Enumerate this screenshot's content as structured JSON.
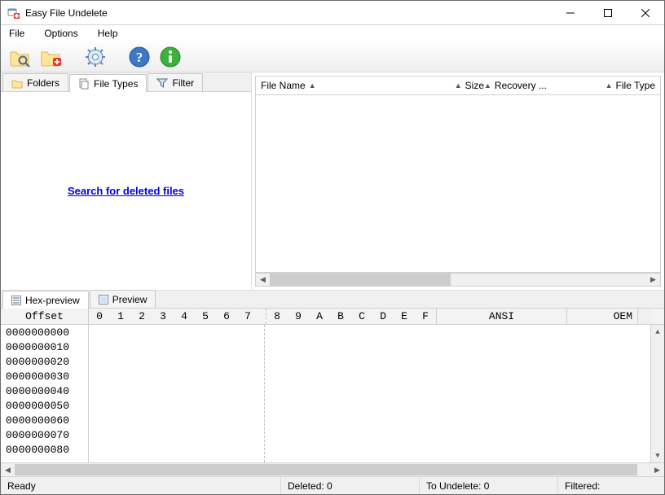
{
  "window": {
    "title": "Easy File Undelete"
  },
  "menus": {
    "file": "File",
    "options": "Options",
    "help": "Help"
  },
  "toolbar": {
    "icons": {
      "scan": "folder-search-icon",
      "add_folder": "folder-add-icon",
      "settings": "gear-icon",
      "help": "help-icon",
      "about": "info-icon"
    }
  },
  "nav_tabs": {
    "folders": "Folders",
    "file_types": "File Types",
    "filter": "Filter"
  },
  "search_link": "Search for deleted files",
  "file_list": {
    "columns": {
      "name": "File Name",
      "size": "Size",
      "recovery": "Recovery ...",
      "type": "File Type"
    }
  },
  "preview_tabs": {
    "hex": "Hex-preview",
    "preview": "Preview"
  },
  "hex": {
    "offset_header": "Offset",
    "byte_cols_left": [
      "0",
      "1",
      "2",
      "3",
      "4",
      "5",
      "6",
      "7"
    ],
    "byte_cols_right": [
      "8",
      "9",
      "A",
      "B",
      "C",
      "D",
      "E",
      "F"
    ],
    "ansi_header": "ANSI",
    "oem_header": "OEM",
    "offsets": [
      "0000000000",
      "0000000010",
      "0000000020",
      "0000000030",
      "0000000040",
      "0000000050",
      "0000000060",
      "0000000070",
      "0000000080"
    ]
  },
  "status": {
    "ready": "Ready",
    "deleted": "Deleted: 0",
    "to_undelete": "To Undelete: 0",
    "filtered": "Filtered:"
  }
}
